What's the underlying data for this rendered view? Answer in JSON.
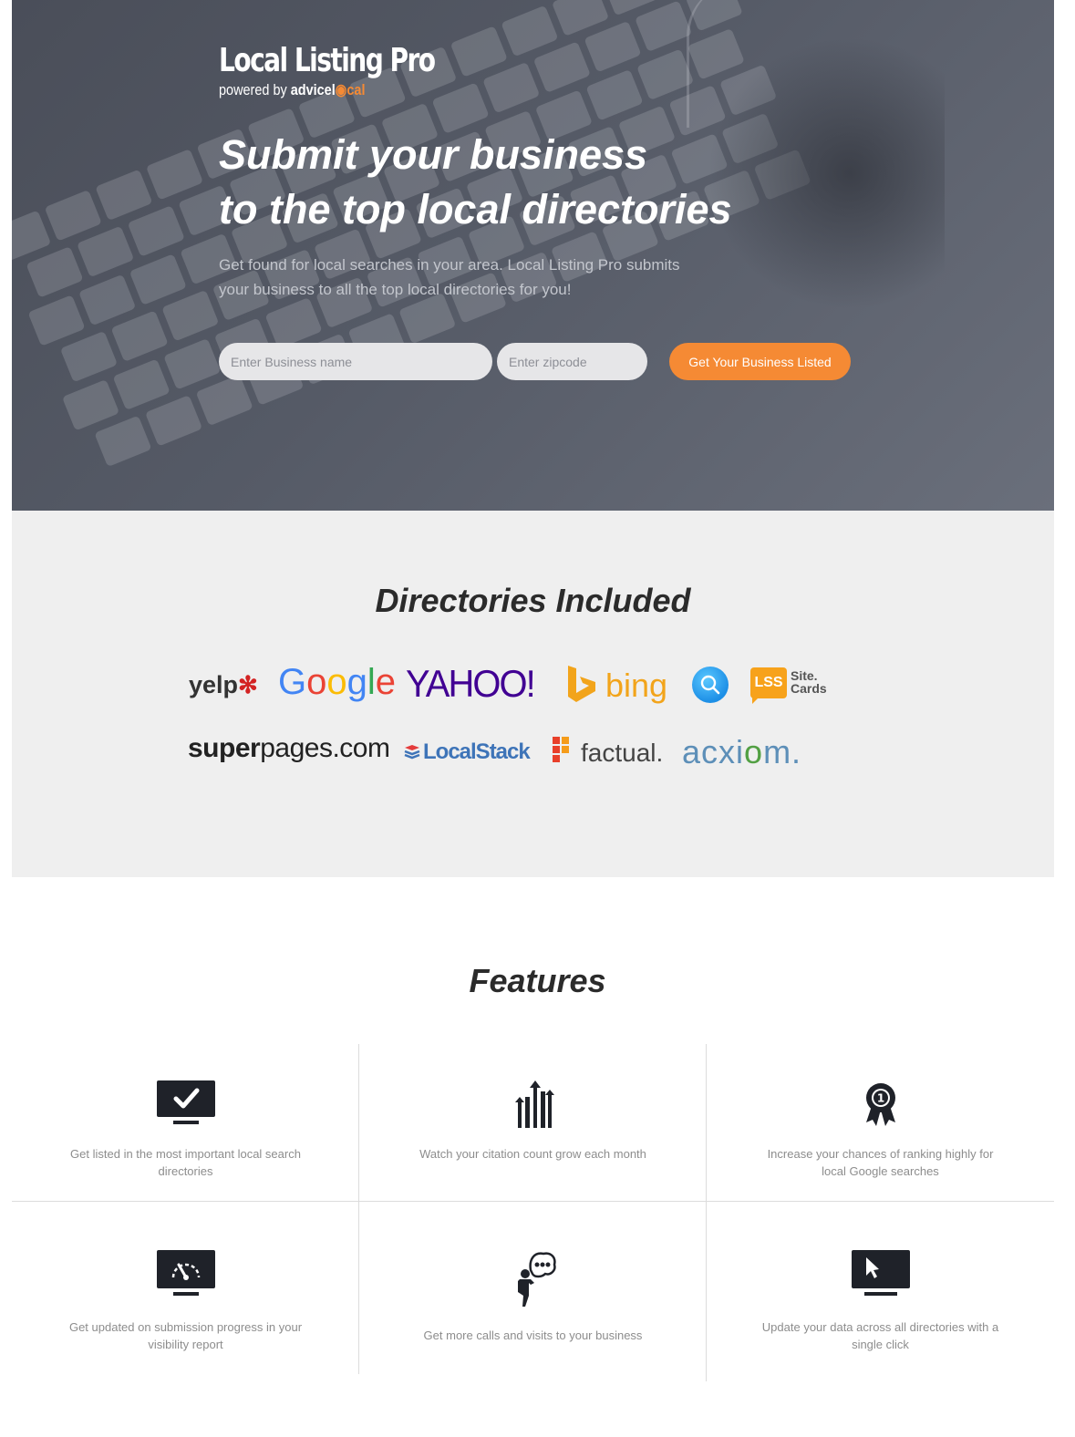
{
  "hero": {
    "brand_name": "Local Listing Pro",
    "brand_powered_prefix": "powered by ",
    "brand_powered_advice": "advice",
    "brand_powered_l": "l",
    "brand_powered_pin": "◉",
    "brand_powered_cal": "cal",
    "title_line1": "Submit your business",
    "title_line2": "to the top local directories",
    "subtitle": "Get found for local searches in your area. Local Listing Pro submits your business to all the top local directories for you!",
    "business_placeholder": "Enter Business name",
    "zip_placeholder": "Enter zipcode",
    "business_value": "",
    "zip_value": "",
    "cta_label": "Get Your Business Listed"
  },
  "directories": {
    "title": "Directories Included",
    "logos": {
      "yelp": "yelp",
      "google_letters": [
        "G",
        "o",
        "o",
        "g",
        "l",
        "e"
      ],
      "google_colors": [
        "#4285f4",
        "#ea4335",
        "#fbbc05",
        "#4285f4",
        "#34a853",
        "#ea4335"
      ],
      "yahoo": "YAHOO!",
      "bing": "bing",
      "lss": "LSS",
      "lss_line1": "Site.",
      "lss_line2": "Cards",
      "superpages_bold": "super",
      "superpages_rest": "pages.com",
      "localstack": "LocalStack",
      "factual": "factual.",
      "acxiom_a": "acxi",
      "acxiom_o": "o",
      "acxiom_b": "m."
    }
  },
  "features": {
    "title": "Features",
    "items": [
      {
        "icon": "monitor-check-icon",
        "text": "Get listed in the most important local search directories"
      },
      {
        "icon": "growth-bars-icon",
        "text": "Watch your citation count grow each month"
      },
      {
        "icon": "award-ribbon-icon",
        "text": "Increase your chances of ranking highly for local Google searches"
      },
      {
        "icon": "monitor-gauge-icon",
        "text": "Get updated on submission progress in your visibility report"
      },
      {
        "icon": "person-speech-icon",
        "text": "Get more calls and visits to your business"
      },
      {
        "icon": "monitor-cursor-icon",
        "text": "Update your data across all directories with a single click"
      }
    ]
  },
  "colors": {
    "accent": "#f58a34",
    "hero_bg": "#555a66",
    "section_bg": "#efefef",
    "icon": "#1f2229"
  }
}
